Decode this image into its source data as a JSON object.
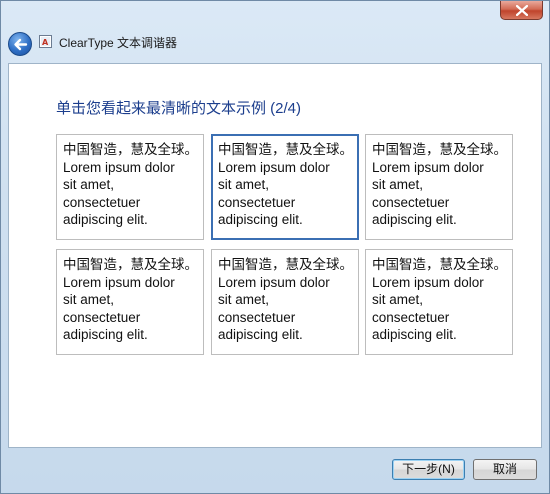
{
  "window": {
    "title": "ClearType 文本调谐器"
  },
  "main": {
    "heading": "单击您看起来最清晰的文本示例 (2/4)",
    "samples": [
      {
        "lines": [
          "中国智造，慧及全球。",
          "Lorem ipsum dolor",
          "sit amet,",
          "consectetuer",
          "adipiscing elit."
        ],
        "selected": false
      },
      {
        "lines": [
          "中国智造，慧及全球。",
          "Lorem ipsum dolor",
          "sit amet,",
          "consectetuer",
          "adipiscing elit."
        ],
        "selected": true
      },
      {
        "lines": [
          "中国智造，慧及全球。",
          "Lorem ipsum dolor",
          "sit amet,",
          "consectetuer",
          "adipiscing elit."
        ],
        "selected": false
      },
      {
        "lines": [
          "中国智造，慧及全球。",
          "Lorem ipsum dolor",
          "sit amet,",
          "consectetuer",
          "adipiscing elit."
        ],
        "selected": false
      },
      {
        "lines": [
          "中国智造，慧及全球。",
          "Lorem ipsum dolor",
          "sit amet,",
          "consectetuer",
          "adipiscing elit."
        ],
        "selected": false
      },
      {
        "lines": [
          "中国智造，慧及全球。",
          "Lorem ipsum dolor",
          "sit amet,",
          "consectetuer",
          "adipiscing elit."
        ],
        "selected": false
      }
    ]
  },
  "footer": {
    "next_label": "下一步(N)",
    "cancel_label": "取消"
  },
  "icons": {
    "close": "close-icon",
    "back": "back-arrow-icon",
    "app": "cleartype-app-icon"
  },
  "colors": {
    "heading": "#1c3e8d",
    "selected_border": "#3b6fb3",
    "close_button": "#c0442c"
  }
}
